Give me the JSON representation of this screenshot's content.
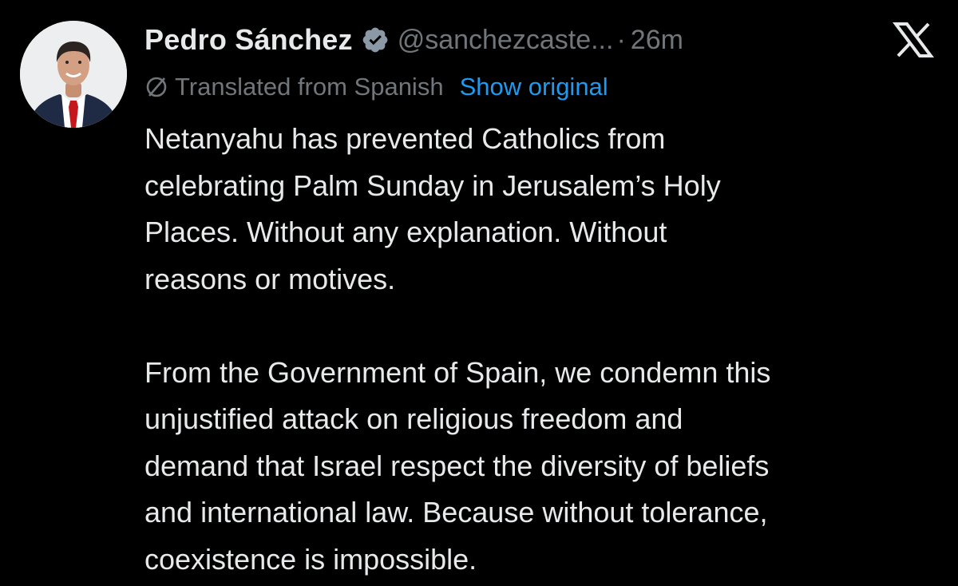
{
  "tweet": {
    "author_name": "Pedro Sánchez",
    "handle": "@sanchezcaste...",
    "separator": "·",
    "time": "26m",
    "verified_icon": "verified-badge-icon",
    "translation_notice": "Translated from Spanish",
    "show_original_label": "Show original",
    "paragraphs": [
      {
        "lines": [
          "Netanyahu has prevented Catholics from",
          "celebrating Palm Sunday in Jerusalem’s Holy",
          "Places. Without any explanation. Without",
          "reasons or motives."
        ]
      },
      {
        "lines": [
          "From the Government of Spain, we condemn this",
          "unjustified attack on religious freedom and",
          "demand that Israel respect the diversity of beliefs",
          "and international law. Because without tolerance,",
          "coexistence is impossible."
        ]
      }
    ]
  },
  "icons": {
    "logo": "x-logo-icon",
    "translate": "globe-slash-icon"
  },
  "colors": {
    "background": "#000000",
    "primary_text": "#e7e9ea",
    "secondary_text": "#71767b",
    "link": "#1d9bf0",
    "verified": "#1d9bf0"
  }
}
